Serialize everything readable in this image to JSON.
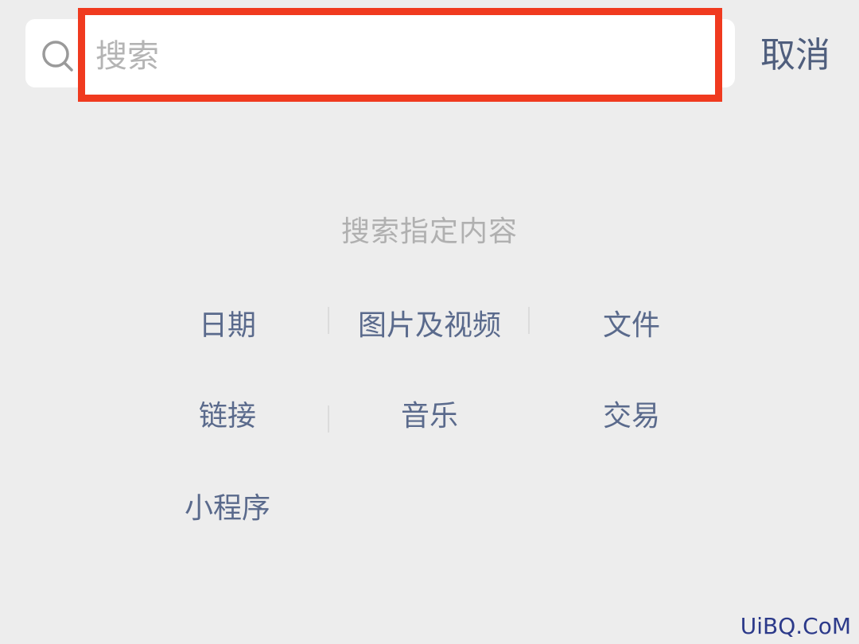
{
  "search": {
    "placeholder": "搜索",
    "value": ""
  },
  "header": {
    "cancel_label": "取消"
  },
  "main": {
    "section_title": "搜索指定内容",
    "categories": [
      {
        "label": "日期"
      },
      {
        "label": "图片及视频"
      },
      {
        "label": "文件"
      },
      {
        "label": "链接"
      },
      {
        "label": "音乐"
      },
      {
        "label": "交易"
      },
      {
        "label": "小程序"
      }
    ]
  },
  "watermark": "UiBQ.CoM",
  "icons": {
    "search": "search-icon"
  },
  "colors": {
    "highlight": "#f03a1f",
    "link": "#5a6a8c",
    "background": "#ededed"
  }
}
